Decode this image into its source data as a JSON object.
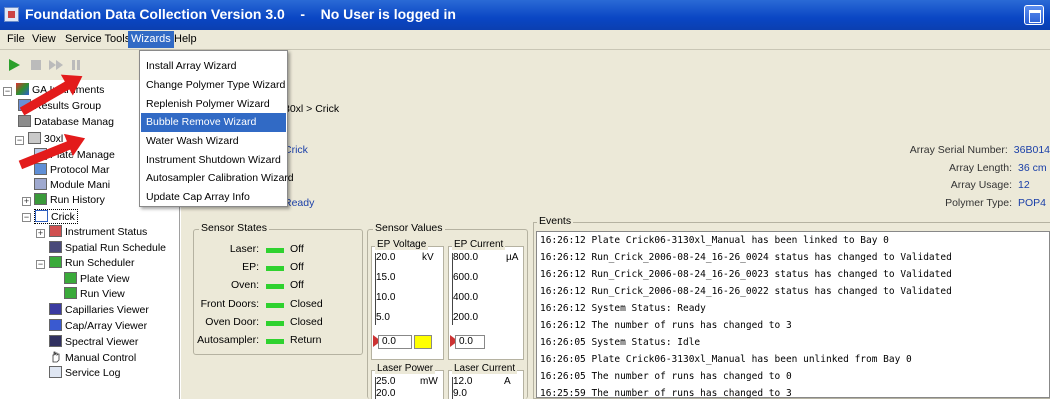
{
  "window": {
    "title": "Foundation Data Collection Version 3.0    -    No User is logged in"
  },
  "menubar": {
    "items": [
      "File",
      "View",
      "Service Tools",
      "Wizards",
      "Help"
    ],
    "active": "Wizards"
  },
  "wizards_menu": {
    "items": [
      "Install Array Wizard",
      "Change Polymer Type Wizard",
      "Replenish Polymer Wizard",
      "Bubble Remove Wizard",
      "Water Wash Wizard",
      "Instrument Shutdown Wizard",
      "Autosampler Calibration Wizard",
      "Update Cap Array Info"
    ],
    "selected": "Bubble Remove Wizard"
  },
  "tree": {
    "items": [
      {
        "label": "GA Instruments",
        "icon": "ga-instruments-icon"
      },
      {
        "label": "Results Group",
        "icon": "results-group-icon"
      },
      {
        "label": "Database Manag",
        "icon": "database-icon"
      },
      {
        "label": "30xl",
        "icon": "instrument-icon"
      },
      {
        "label": "Plate Manage",
        "icon": "plate-icon"
      },
      {
        "label": "Protocol Mar",
        "icon": "protocol-icon"
      },
      {
        "label": "Module Mani",
        "icon": "module-icon"
      },
      {
        "label": "Run History",
        "icon": "run-history-icon"
      },
      {
        "label": "Crick",
        "icon": "crick-icon"
      },
      {
        "label": "Instrument Status",
        "icon": "instrument-status-icon"
      },
      {
        "label": "Spatial Run Schedule",
        "icon": "spatial-run-icon"
      },
      {
        "label": "Run Scheduler",
        "icon": "run-scheduler-icon"
      },
      {
        "label": "Plate View",
        "icon": "plate-view-icon"
      },
      {
        "label": "Run View",
        "icon": "run-view-icon"
      },
      {
        "label": "Capillaries Viewer",
        "icon": "capillaries-icon"
      },
      {
        "label": "Cap/Array Viewer",
        "icon": "cap-array-icon"
      },
      {
        "label": "Spectral Viewer",
        "icon": "spectral-icon"
      },
      {
        "label": "Manual Control",
        "icon": "manual-control-icon"
      },
      {
        "label": "Service Log",
        "icon": "service-log-icon"
      }
    ]
  },
  "main": {
    "breadcrumb": "30xl > Crick",
    "instrument_name": "Crick",
    "instrument_status": "Ready",
    "array_info": [
      {
        "label": "Array Serial Number:",
        "value": "36B014"
      },
      {
        "label": "Array Length:",
        "value": "36  cm"
      },
      {
        "label": "Array Usage:",
        "value": "12"
      },
      {
        "label": "Polymer Type:",
        "value": "POP4"
      }
    ],
    "sensor_states": {
      "title": "Sensor States",
      "rows": [
        {
          "label": "Laser:",
          "state": "Off"
        },
        {
          "label": "EP:",
          "state": "Off"
        },
        {
          "label": "Oven:",
          "state": "Off"
        },
        {
          "label": "Front Doors:",
          "state": "Closed"
        },
        {
          "label": "Oven Door:",
          "state": "Closed"
        },
        {
          "label": "Autosampler:",
          "state": "Return"
        }
      ]
    },
    "sensor_values": {
      "title": "Sensor Values",
      "ep_voltage": {
        "title": "EP Voltage",
        "unit": "kV",
        "ticks": [
          "20.0",
          "15.0",
          "10.0",
          "5.0"
        ],
        "reading": "0.0"
      },
      "ep_current": {
        "title": "EP Current",
        "unit": "µA",
        "ticks": [
          "800.0",
          "600.0",
          "400.0",
          "200.0"
        ],
        "reading": "0.0"
      },
      "laser_power": {
        "title": "Laser Power",
        "unit": "mW",
        "ticks": [
          "25.0",
          "20.0"
        ]
      },
      "laser_current": {
        "title": "Laser Current",
        "unit": "A",
        "ticks": [
          "12.0",
          "9.0"
        ]
      }
    },
    "events": {
      "title": "Events",
      "lines": [
        "16:26:12 Plate Crick06-3130xl_Manual has been linked to Bay 0",
        "16:26:12 Run_Crick_2006-08-24_16-26_0024 status has changed to Validated",
        "16:26:12 Run_Crick_2006-08-24_16-26_0023 status has changed to Validated",
        "16:26:12 Run_Crick_2006-08-24_16-26_0022 status has changed to Validated",
        "16:26:12 System Status: Ready",
        "16:26:12 The number of runs has changed to 3",
        "16:26:05 System Status: Idle",
        "16:26:05 Plate Crick06-3130xl_Manual has been unlinked from Bay 0",
        "16:26:05 The number of runs has changed to 0",
        "16:25:59 The number of runs has changed to 3"
      ]
    }
  },
  "colors": {
    "titlebar": "#0a46c4",
    "selection": "#316ac5",
    "link_text": "#1a3fa8",
    "led_green": "#2fd22f",
    "annotation_arrow": "#e31b1b"
  }
}
